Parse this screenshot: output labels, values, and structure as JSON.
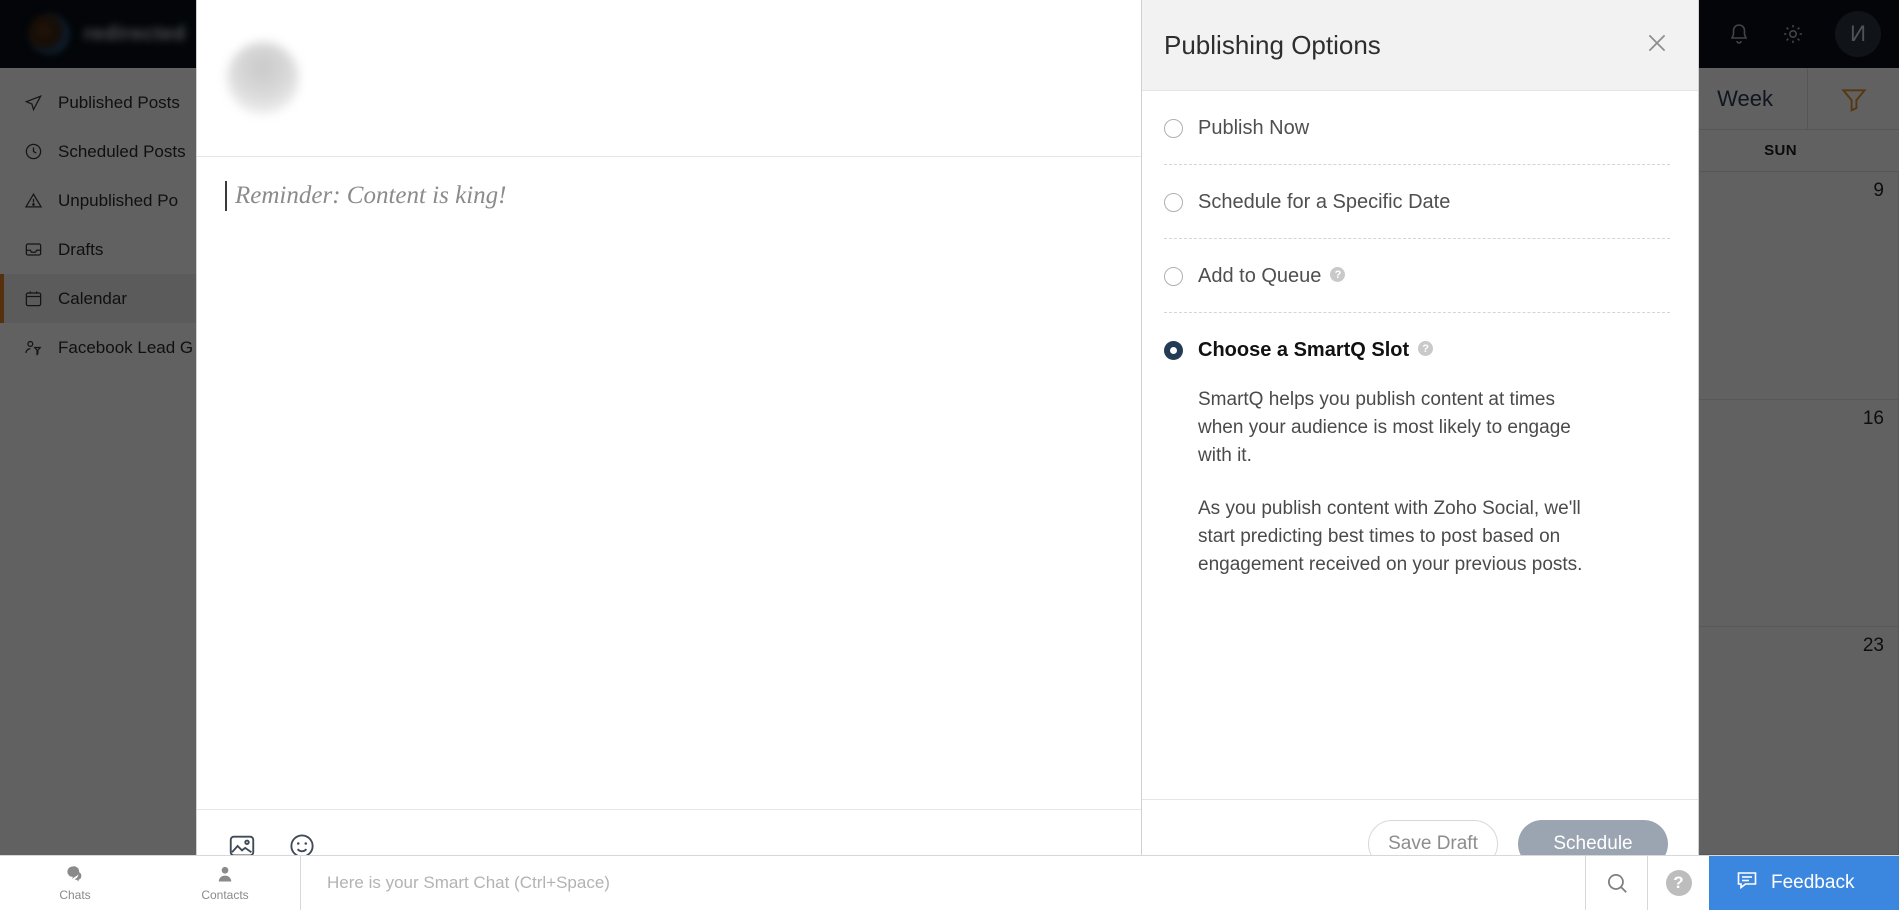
{
  "topbar": {
    "brand_name": "redirected",
    "icons": [
      "list-icon",
      "bell-icon",
      "gear-icon"
    ],
    "avatar_initial": "И"
  },
  "sidebar": {
    "items": [
      {
        "label": "Published Posts",
        "icon": "send-icon",
        "active": false
      },
      {
        "label": "Scheduled Posts",
        "icon": "clock-icon",
        "active": false
      },
      {
        "label": "Unpublished Po",
        "icon": "warning-icon",
        "active": false
      },
      {
        "label": "Drafts",
        "icon": "inbox-icon",
        "active": false
      },
      {
        "label": "Calendar",
        "icon": "calendar-icon",
        "active": true
      },
      {
        "label": "Facebook Lead G",
        "icon": "lead-gen-icon",
        "active": false
      }
    ]
  },
  "calendar": {
    "view_tab": "Week",
    "filter_icon": "funnel-icon",
    "columns": [
      "SUN"
    ],
    "dates": [
      "9",
      "16",
      "23"
    ]
  },
  "composer": {
    "placeholder": "Reminder: Content is king!",
    "toolbar_icons": [
      "image-icon",
      "emoji-icon"
    ]
  },
  "options": {
    "title": "Publishing Options",
    "close_icon": "close-icon",
    "items": [
      {
        "label": "Publish Now",
        "selected": false,
        "has_help": false
      },
      {
        "label": "Schedule for a Specific Date",
        "selected": false,
        "has_help": false
      },
      {
        "label": "Add to Queue",
        "selected": false,
        "has_help": true
      },
      {
        "label": "Choose a SmartQ Slot",
        "selected": true,
        "has_help": true
      }
    ],
    "description_1": "SmartQ helps you publish content at times when your audience is most likely to engage with it.",
    "description_2": "As you publish content with Zoho Social, we'll start predicting best times to post based on engagement received on your previous posts.",
    "save_draft_label": "Save Draft",
    "schedule_label": "Schedule"
  },
  "chatbar": {
    "chats_label": "Chats",
    "contacts_label": "Contacts",
    "input_placeholder": "Here is your Smart Chat (Ctrl+Space)",
    "search_icon": "search-icon",
    "help_label": "?",
    "feedback_label": "Feedback"
  },
  "colors": {
    "topbar": "#080f18",
    "accent_orange": "#e27b23",
    "radio_selected": "#233b54",
    "feedback_blue": "#3b87e0",
    "schedule_button": "#9ba5b2"
  }
}
